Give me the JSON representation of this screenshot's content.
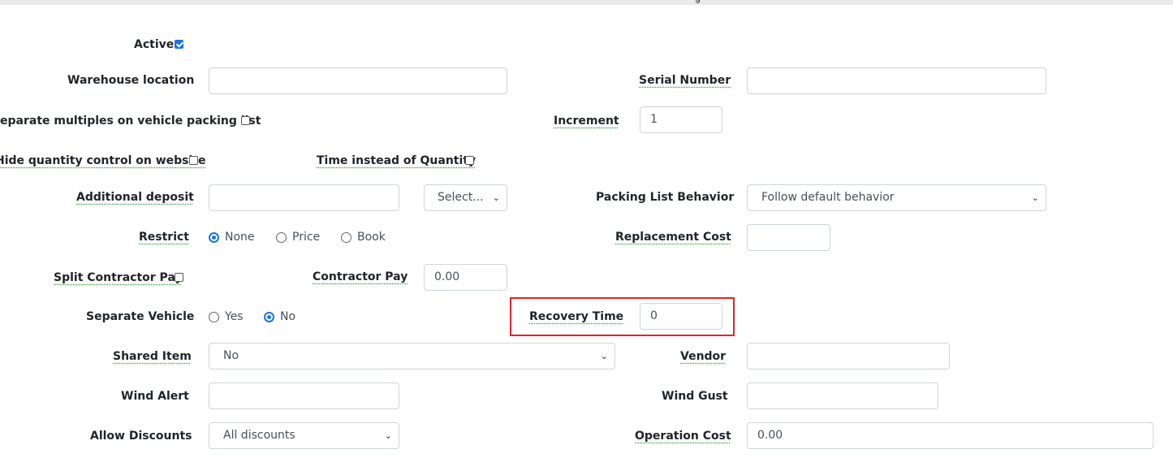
{
  "form": {
    "active": {
      "label": "Active",
      "checked": true
    },
    "warehouse_location": {
      "label": "Warehouse location",
      "value": ""
    },
    "serial_number": {
      "label": "Serial Number",
      "value": ""
    },
    "separate_multiples": {
      "label": "eparate multiples on vehicle packing list",
      "checked": false
    },
    "increment": {
      "label": "Increment",
      "value": "1"
    },
    "hide_quantity": {
      "label": "Hide quantity control on website",
      "checked": false
    },
    "time_instead": {
      "label": "Time instead of Quantity",
      "checked": false
    },
    "additional_deposit": {
      "label": "Additional deposit",
      "value": "",
      "select_value": "Select..."
    },
    "packing_list_behavior": {
      "label": "Packing List Behavior",
      "value": "Follow default behavior"
    },
    "restrict": {
      "label": "Restrict",
      "options": [
        "None",
        "Price",
        "Book"
      ],
      "selected": "None"
    },
    "replacement_cost": {
      "label": "Replacement Cost",
      "value": ""
    },
    "split_contractor_pay": {
      "label": "Split Contractor Pay",
      "checked": false
    },
    "contractor_pay": {
      "label": "Contractor Pay",
      "value": "0.00"
    },
    "separate_vehicle": {
      "label": "Separate Vehicle",
      "options": [
        "Yes",
        "No"
      ],
      "selected": "No"
    },
    "recovery_time": {
      "label": "Recovery Time",
      "value": "0",
      "highlighted": true
    },
    "shared_item": {
      "label": "Shared Item",
      "value": "No"
    },
    "vendor": {
      "label": "Vendor",
      "value": ""
    },
    "wind_alert": {
      "label": "Wind Alert",
      "value": ""
    },
    "wind_gust": {
      "label": "Wind Gust",
      "value": ""
    },
    "allow_discounts": {
      "label": "Allow Discounts",
      "value": "All discounts"
    },
    "operation_cost": {
      "label": "Operation Cost",
      "value": "0.00"
    }
  },
  "icons": {
    "select_caret": "chevron-down-icon"
  },
  "colors": {
    "accent": "#1a73e8",
    "highlight_border": "#e0242a",
    "input_border": "#ced4da"
  }
}
